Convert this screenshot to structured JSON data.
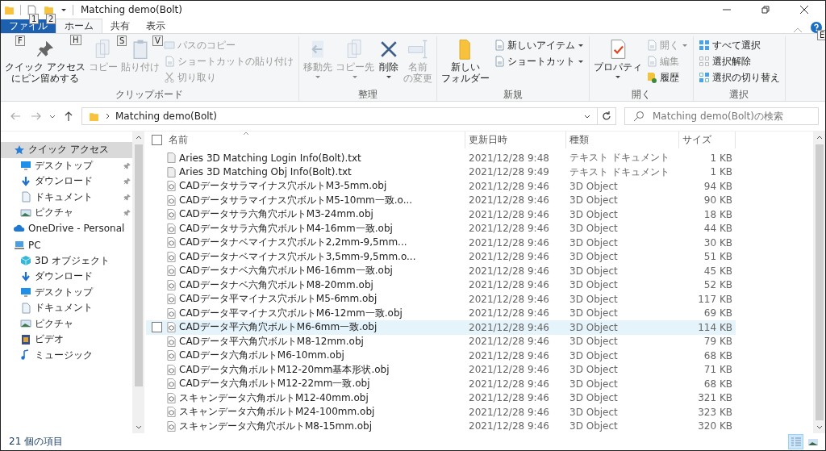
{
  "window": {
    "title": "Matching demo(Bolt)",
    "quick_access_keytips": [
      "1",
      "2"
    ]
  },
  "tabs": [
    {
      "label": "ファイル",
      "key": "F",
      "selected": false,
      "kind": "file"
    },
    {
      "label": "ホーム",
      "key": "H",
      "selected": true,
      "kind": "tab"
    },
    {
      "label": "共有",
      "key": "S",
      "selected": false,
      "kind": "tab"
    },
    {
      "label": "表示",
      "key": "V",
      "selected": false,
      "kind": "tab"
    }
  ],
  "help_keytip": "E",
  "ribbon": {
    "groups": [
      {
        "label": "クリップボード",
        "items": [
          {
            "kind": "large",
            "label": [
              "クイック アクセス",
              "にピン留めする"
            ],
            "disabled": false
          },
          {
            "kind": "large",
            "label": "コピー",
            "disabled": true
          },
          {
            "kind": "large",
            "label": "貼り付け",
            "disabled": true
          },
          {
            "kind": "small",
            "label": "パスのコピー",
            "disabled": true
          },
          {
            "kind": "small",
            "label": "ショートカットの貼り付け",
            "disabled": true
          },
          {
            "kind": "small",
            "label": "切り取り",
            "disabled": true
          }
        ]
      },
      {
        "label": "整理",
        "items": [
          {
            "kind": "large",
            "label": "移動先",
            "disabled": true,
            "dropdown": true
          },
          {
            "kind": "large",
            "label": "コピー先",
            "disabled": true,
            "dropdown": true
          },
          {
            "kind": "large",
            "label": "削除",
            "disabled": false,
            "dropdown": true
          },
          {
            "kind": "large",
            "label": [
              "名前",
              "の変更"
            ],
            "disabled": true
          }
        ]
      },
      {
        "label": "新規",
        "items": [
          {
            "kind": "large",
            "label": [
              "新しい",
              "フォルダー"
            ],
            "disabled": false
          },
          {
            "kind": "small",
            "label": "新しいアイテム",
            "disabled": false,
            "dropdown": true
          },
          {
            "kind": "small",
            "label": "ショートカット",
            "disabled": false,
            "dropdown": true
          }
        ]
      },
      {
        "label": "開く",
        "items": [
          {
            "kind": "large",
            "label": "プロパティ",
            "disabled": false,
            "dropdown": true
          },
          {
            "kind": "small",
            "label": "開く",
            "disabled": true,
            "dropdown": true
          },
          {
            "kind": "small",
            "label": "編集",
            "disabled": true
          },
          {
            "kind": "small",
            "label": "履歴",
            "disabled": false
          }
        ]
      },
      {
        "label": "選択",
        "items": [
          {
            "kind": "small",
            "label": "すべて選択",
            "disabled": false
          },
          {
            "kind": "small",
            "label": "選択解除",
            "disabled": false
          },
          {
            "kind": "small",
            "label": "選択の切り替え",
            "disabled": false
          }
        ]
      }
    ]
  },
  "address": {
    "path": "Matching demo(Bolt)",
    "search_placeholder": "Matching demo(Bolt)の検索"
  },
  "nav": [
    {
      "label": "クイック アクセス",
      "selected": true,
      "pinned": false,
      "children": [
        {
          "label": "デスクトップ",
          "selected": false,
          "pinned": true
        },
        {
          "label": "ダウンロード",
          "selected": false,
          "pinned": true
        },
        {
          "label": "ドキュメント",
          "selected": false,
          "pinned": true
        },
        {
          "label": "ピクチャ",
          "selected": false,
          "pinned": true
        }
      ]
    },
    {
      "label": "OneDrive - Personal",
      "selected": false,
      "pinned": false
    },
    {
      "label": "PC",
      "selected": false,
      "pinned": false,
      "children": [
        {
          "label": "3D オブジェクト",
          "selected": false,
          "pinned": false
        },
        {
          "label": "ダウンロード",
          "selected": false,
          "pinned": false
        },
        {
          "label": "デスクトップ",
          "selected": false,
          "pinned": false
        },
        {
          "label": "ドキュメント",
          "selected": false,
          "pinned": false
        },
        {
          "label": "ピクチャ",
          "selected": false,
          "pinned": false
        },
        {
          "label": "ビデオ",
          "selected": false,
          "pinned": false
        },
        {
          "label": "ミュージック",
          "selected": false,
          "pinned": false
        }
      ]
    }
  ],
  "table": {
    "columns": [
      "名前",
      "更新日時",
      "種類",
      "サイズ"
    ],
    "all_checked": false,
    "rows": [
      {
        "kind": "txt",
        "name": "Aries 3D Matching Login Info(Bolt).txt",
        "date": "2021/12/28 9:48",
        "type": "テキスト ドキュメント",
        "size": "1 KB",
        "hovered": false
      },
      {
        "kind": "txt",
        "name": "Aries 3D Matching Obj Info(Bolt).txt",
        "date": "2021/12/28 9:49",
        "type": "テキスト ドキュメント",
        "size": "1 KB",
        "hovered": false
      },
      {
        "kind": "obj",
        "name": "CADデータサラマイナス穴ボルトM3-5mm.obj",
        "date": "2021/12/28 9:46",
        "type": "3D Object",
        "size": "94 KB",
        "hovered": false
      },
      {
        "kind": "obj",
        "name": "CADデータサラマイナス穴ボルトM5-10mm一致.o...",
        "date": "2021/12/28 9:46",
        "type": "3D Object",
        "size": "90 KB",
        "hovered": false
      },
      {
        "kind": "obj",
        "name": "CADデータサラ六角穴ボルトM3-24mm.obj",
        "date": "2021/12/28 9:46",
        "type": "3D Object",
        "size": "18 KB",
        "hovered": false
      },
      {
        "kind": "obj",
        "name": "CADデータサラ六角穴ボルトM4-16mm一致.obj",
        "date": "2021/12/28 9:46",
        "type": "3D Object",
        "size": "44 KB",
        "hovered": false
      },
      {
        "kind": "obj",
        "name": "CADデータナベマイナス穴ボルト2,2mm-9,5mm...",
        "date": "2021/12/28 9:46",
        "type": "3D Object",
        "size": "30 KB",
        "hovered": false
      },
      {
        "kind": "obj",
        "name": "CADデータナベマイナス穴ボルト3,5mm-9,5mm.o...",
        "date": "2021/12/28 9:46",
        "type": "3D Object",
        "size": "51 KB",
        "hovered": false
      },
      {
        "kind": "obj",
        "name": "CADデータナベ六角穴ボルトM6-16mm一致.obj",
        "date": "2021/12/28 9:46",
        "type": "3D Object",
        "size": "45 KB",
        "hovered": false
      },
      {
        "kind": "obj",
        "name": "CADデータナベ六角穴ボルトM8-20mm.obj",
        "date": "2021/12/28 9:46",
        "type": "3D Object",
        "size": "52 KB",
        "hovered": false
      },
      {
        "kind": "obj",
        "name": "CADデータ平マイナス穴ボルトM5-6mm.obj",
        "date": "2021/12/28 9:46",
        "type": "3D Object",
        "size": "117 KB",
        "hovered": false
      },
      {
        "kind": "obj",
        "name": "CADデータ平マイナス穴ボルトM6-12mm一致.obj",
        "date": "2021/12/28 9:46",
        "type": "3D Object",
        "size": "69 KB",
        "hovered": false
      },
      {
        "kind": "obj",
        "name": "CADデータ平六角穴ボルトM6-6mm一致.obj",
        "date": "2021/12/28 9:46",
        "type": "3D Object",
        "size": "114 KB",
        "hovered": true
      },
      {
        "kind": "obj",
        "name": "CADデータ平六角穴ボルトM8-12mm.obj",
        "date": "2021/12/28 9:46",
        "type": "3D Object",
        "size": "79 KB",
        "hovered": false
      },
      {
        "kind": "obj",
        "name": "CADデータ六角ボルトM6-10mm.obj",
        "date": "2021/12/28 9:46",
        "type": "3D Object",
        "size": "68 KB",
        "hovered": false
      },
      {
        "kind": "obj",
        "name": "CADデータ六角ボルトM12-20mm基本形状.obj",
        "date": "2021/12/28 9:46",
        "type": "3D Object",
        "size": "71 KB",
        "hovered": false
      },
      {
        "kind": "obj",
        "name": "CADデータ六角ボルトM12-22mm一致.obj",
        "date": "2021/12/28 9:46",
        "type": "3D Object",
        "size": "68 KB",
        "hovered": false
      },
      {
        "kind": "obj",
        "name": "スキャンデータ六角ボルトM12-40mm.obj",
        "date": "2021/12/28 9:46",
        "type": "3D Object",
        "size": "321 KB",
        "hovered": false
      },
      {
        "kind": "obj",
        "name": "スキャンデータ六角ボルトM24-100mm.obj",
        "date": "2021/12/28 9:46",
        "type": "3D Object",
        "size": "323 KB",
        "hovered": false
      },
      {
        "kind": "obj",
        "name": "スキャンデータ六角穴ボルトM8-15mm.obj",
        "date": "2021/12/28 9:46",
        "type": "3D Object",
        "size": "320 KB",
        "hovered": false
      }
    ]
  },
  "status_bar": {
    "count": "21 個の項目",
    "views": [
      {
        "kind": "details",
        "selected": true
      },
      {
        "kind": "large_icons",
        "selected": false
      }
    ]
  }
}
